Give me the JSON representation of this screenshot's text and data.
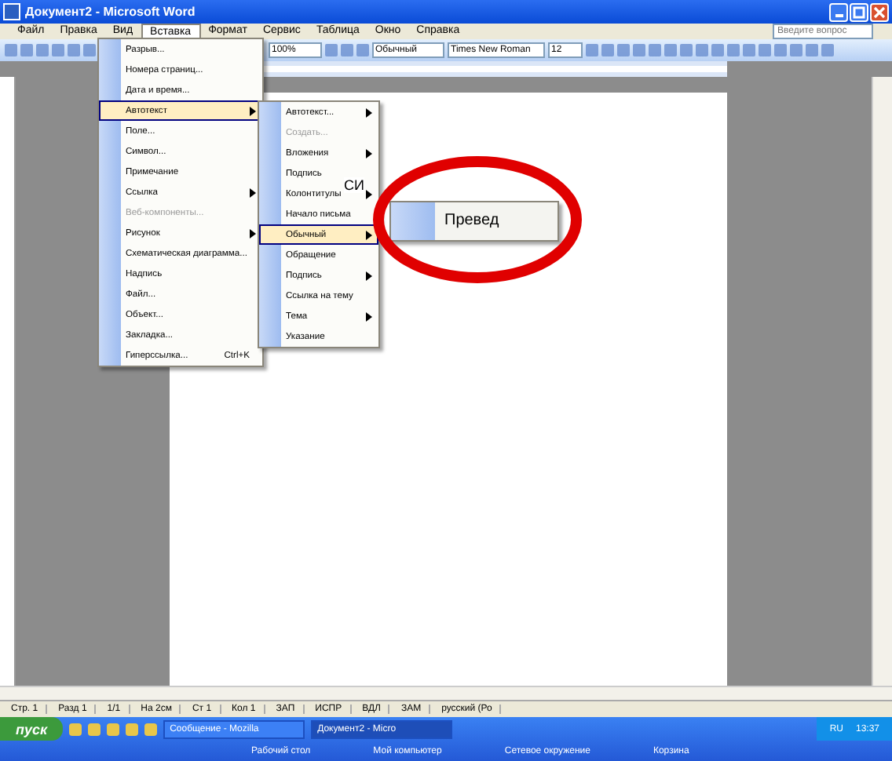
{
  "window": {
    "title": "Документ2 - Microsoft Word"
  },
  "menu_bar": [
    {
      "label": "Файл",
      "selected": false
    },
    {
      "label": "Правка",
      "selected": false
    },
    {
      "label": "Вид",
      "selected": false
    },
    {
      "label": "Вставка",
      "selected": true
    },
    {
      "label": "Формат",
      "selected": false
    },
    {
      "label": "Сервис",
      "selected": false
    },
    {
      "label": "Таблица",
      "selected": false
    },
    {
      "label": "Окно",
      "selected": false
    },
    {
      "label": "Справка",
      "selected": false
    }
  ],
  "help_box": {
    "placeholder": "Введите вопрос"
  },
  "toolbar": {
    "zoom": "100%",
    "style": "Обычный",
    "font": "Times New Roman",
    "size": "12"
  },
  "insert_menu": [
    {
      "label": "Разрыв...",
      "selected": false,
      "submenu": false,
      "disabled": false
    },
    {
      "label": "Номера страниц...",
      "selected": false,
      "submenu": false,
      "disabled": false
    },
    {
      "label": "Дата и время...",
      "selected": false,
      "submenu": false,
      "disabled": false
    },
    {
      "label": "Автотекст",
      "selected": true,
      "submenu": true,
      "disabled": false
    },
    {
      "label": "Поле...",
      "selected": false,
      "submenu": false,
      "disabled": false
    },
    {
      "label": "Символ...",
      "selected": false,
      "submenu": false,
      "disabled": false
    },
    {
      "label": "Примечание",
      "selected": false,
      "submenu": false,
      "disabled": false
    },
    {
      "label": "Ссылка",
      "selected": false,
      "submenu": true,
      "disabled": false
    },
    {
      "label": "Веб-компоненты...",
      "selected": false,
      "submenu": false,
      "disabled": true
    },
    {
      "label": "Рисунок",
      "selected": false,
      "submenu": true,
      "disabled": false
    },
    {
      "label": "Схематическая диаграмма...",
      "selected": false,
      "submenu": false,
      "disabled": false
    },
    {
      "label": "Надпись",
      "selected": false,
      "submenu": false,
      "disabled": false
    },
    {
      "label": "Файл...",
      "selected": false,
      "submenu": false,
      "disabled": false
    },
    {
      "label": "Объект...",
      "selected": false,
      "submenu": false,
      "disabled": false
    },
    {
      "label": "Закладка...",
      "selected": false,
      "submenu": false,
      "disabled": false
    },
    {
      "label": "Гиперссылка...",
      "selected": false,
      "submenu": false,
      "disabled": false,
      "shortcut": "Ctrl+K"
    }
  ],
  "autotext_menu": [
    {
      "label": "Автотекст...",
      "selected": false,
      "submenu": true,
      "disabled": false
    },
    {
      "label": "Создать...",
      "selected": false,
      "submenu": false,
      "disabled": true
    },
    {
      "label": "Вложения",
      "selected": false,
      "submenu": true,
      "disabled": false
    },
    {
      "label": "Подпись",
      "selected": false,
      "submenu": false,
      "disabled": false
    },
    {
      "label": "Колонтитулы",
      "selected": false,
      "submenu": true,
      "disabled": false
    },
    {
      "label": "Начало письма",
      "selected": false,
      "submenu": false,
      "disabled": false
    },
    {
      "label": "Обычный",
      "selected": true,
      "submenu": true,
      "disabled": false
    },
    {
      "label": "Обращение",
      "selected": false,
      "submenu": false,
      "disabled": false
    },
    {
      "label": "Подпись",
      "selected": false,
      "submenu": true,
      "disabled": false
    },
    {
      "label": "Ссылка на тему",
      "selected": false,
      "submenu": false,
      "disabled": false
    },
    {
      "label": "Тема",
      "selected": false,
      "submenu": true,
      "disabled": false
    },
    {
      "label": "Указание",
      "selected": false,
      "submenu": false,
      "disabled": false
    }
  ],
  "stray_text": "СИ",
  "style_menu": [
    {
      "label": "Превед",
      "selected": false
    }
  ],
  "status_bar": [
    "Стр. 1",
    "Разд 1",
    "1/1",
    "На 2см",
    "Ст 1",
    "Кол 1",
    "ЗАП",
    "ИСПР",
    "ВДЛ",
    "ЗАМ",
    "русский (Ро"
  ],
  "taskbar": {
    "start": "пуск",
    "tasks": [
      {
        "label": "Сообщение - Mozilla",
        "selected": false
      },
      {
        "label": "Документ2 - Micro",
        "selected": true
      }
    ],
    "tasks_row2": [
      "Рабочий стол",
      "Мой компьютер",
      "Сетевое окружение",
      "Корзина"
    ],
    "tray": "RU",
    "clock": "13:37"
  }
}
